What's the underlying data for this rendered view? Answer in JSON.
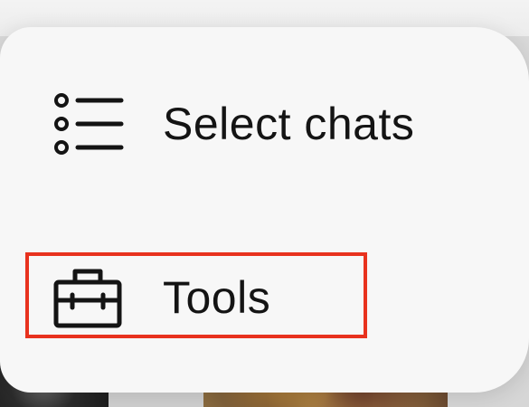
{
  "menu": {
    "items": [
      {
        "label": "Select chats",
        "icon": "list-bullets-icon"
      },
      {
        "label": "Tools",
        "icon": "toolbox-icon"
      }
    ]
  },
  "annotation": {
    "highlight_color": "#e8321e"
  }
}
